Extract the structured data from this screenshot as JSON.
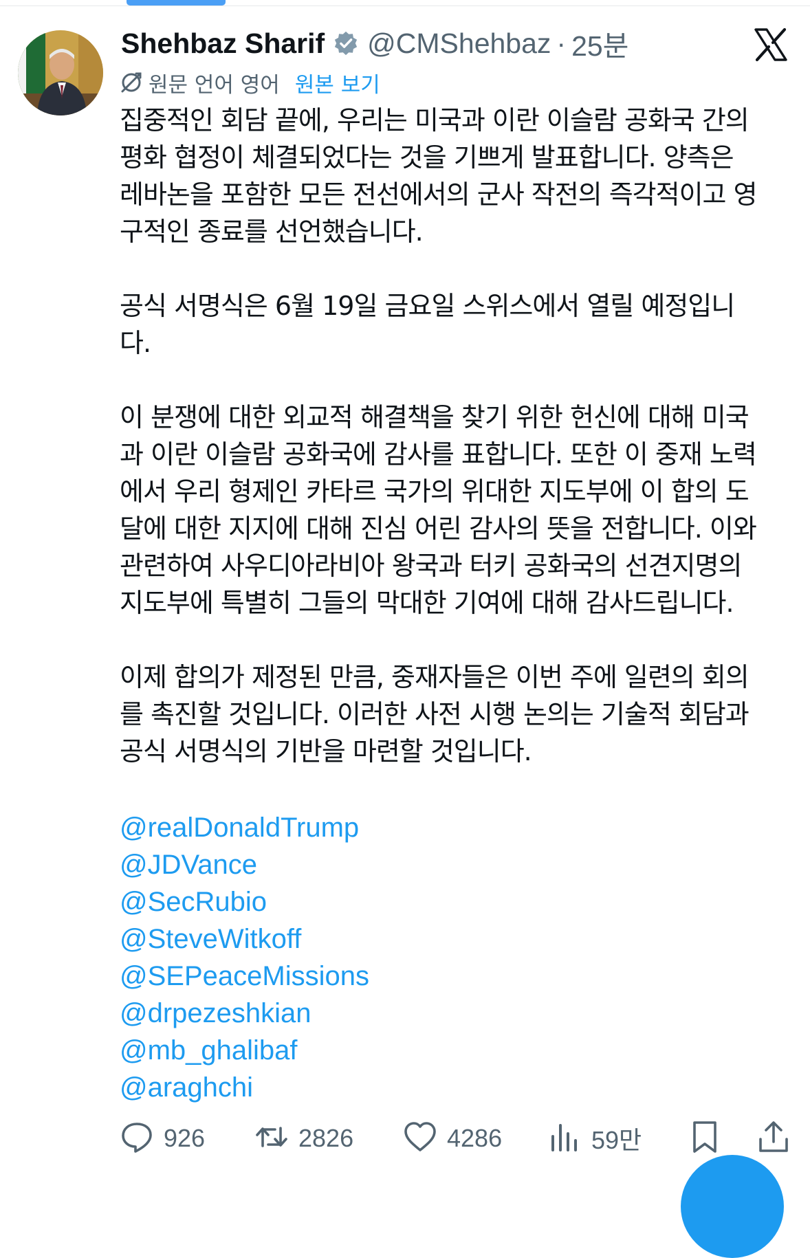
{
  "author": {
    "display_name": "Shehbaz Sharif",
    "handle": "@CMShehbaz",
    "separator": "·",
    "time": "25분"
  },
  "translation": {
    "note": "원문 언어 영어",
    "show_original": "원본 보기"
  },
  "body": {
    "p1": "집중적인 회담 끝에, 우리는 미국과 이란 이슬람 공화국 간의\n평화 협정이 체결되었다는 것을 기쁘게 발표합니다. 양측은\n레바논을 포함한 모든 전선에서의 군사 작전의 즉각적이고 영\n구적인 종료를 선언했습니다.",
    "p2": "공식 서명식은 6월 19일 금요일 스위스에서 열릴 예정입니\n다.",
    "p3": "이 분쟁에 대한 외교적 해결책을 찾기 위한 헌신에 대해 미국\n과 이란 이슬람 공화국에 감사를 표합니다. 또한 이 중재 노력\n에서 우리 형제인 카타르 국가의 위대한 지도부에 이 합의 도\n달에 대한 지지에 대해 진심 어린 감사의 뜻을 전합니다. 이와\n관련하여 사우디아라비아 왕국과 터키 공화국의 선견지명의\n지도부에 특별히 그들의 막대한 기여에 대해 감사드립니다.",
    "p4": "이제 합의가 제정된 만큼, 중재자들은 이번 주에 일련의 회의\n를 촉진할 것입니다. 이러한 사전 시행 논의는 기술적 회담과\n공식 서명식의 기반을 마련할 것입니다."
  },
  "mentions": [
    "@realDonaldTrump",
    "@JDVance",
    "@SecRubio",
    "@SteveWitkoff",
    "@SEPeaceMissions",
    "@drpezeshkian",
    "@mb_ghalibaf",
    "@araghchi"
  ],
  "actions": {
    "replies": "926",
    "reposts": "2826",
    "likes": "4286",
    "views": "59만"
  },
  "icons": {
    "verified": "verified-badge-icon",
    "translate": "translate-icon",
    "logo": "x-logo-icon",
    "reply": "reply-icon",
    "repost": "repost-icon",
    "like": "heart-icon",
    "views": "views-icon",
    "bookmark": "bookmark-icon",
    "share": "share-icon"
  },
  "colors": {
    "link": "#1d9bf0",
    "muted": "#536471",
    "text": "#0f1419"
  }
}
